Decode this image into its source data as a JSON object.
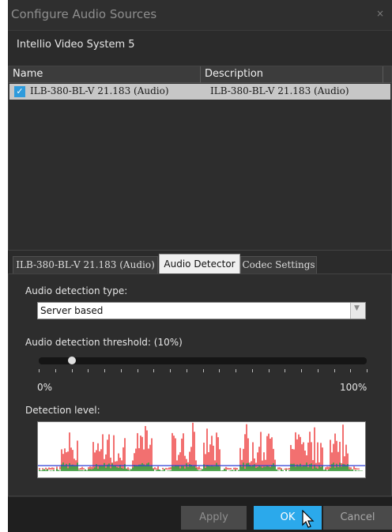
{
  "window": {
    "title": "Configure Audio Sources",
    "close_glyph": "×"
  },
  "system_name": "Intellio Video System 5",
  "source_list": {
    "columns": [
      "Name",
      "Description"
    ],
    "rows": [
      {
        "checked": true,
        "name": "ILB-380-BL-V 21.183 (Audio)",
        "description": "ILB-380-BL-V 21.183 (Audio)"
      }
    ]
  },
  "tabs": [
    {
      "label": "ILB-380-BL-V 21.183 (Audio)",
      "active": false
    },
    {
      "label": "Audio Detector",
      "active": true
    },
    {
      "label": "Codec Settings",
      "active": false
    }
  ],
  "audio_detector": {
    "type_label": "Audio detection type:",
    "type_value": "Server based",
    "threshold_label": "Audio detection threshold: (10%)",
    "threshold_percent": 10,
    "slider_min_label": "0%",
    "slider_max_label": "100%",
    "level_label": "Detection level:"
  },
  "buttons": {
    "apply": "Apply",
    "ok": "OK",
    "cancel": "Cancel"
  },
  "colors": {
    "dialog_bg": "#2b2b2b",
    "accent": "#2ba9eb",
    "waveform_level": "#e81010",
    "waveform_baseline": "#1a8a1a",
    "threshold_line": "#2f3fd8"
  }
}
